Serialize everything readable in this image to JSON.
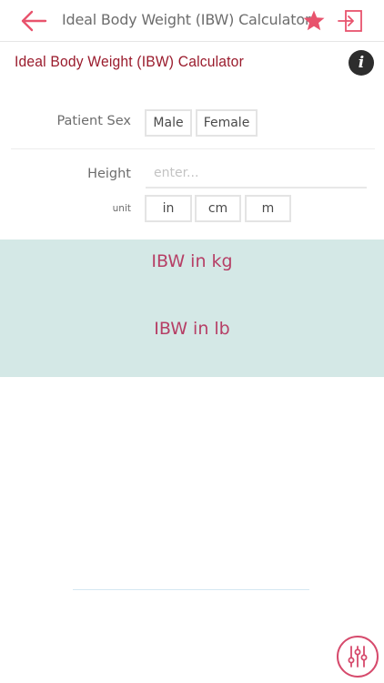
{
  "navbar": {
    "title": "Ideal Body Weight (IBW) Calculator",
    "back_icon": "arrow-left-icon",
    "favorite_icon": "star-icon",
    "exit_icon": "exit-icon"
  },
  "header": {
    "title": "Ideal Body Weight (IBW) Calculator",
    "info_glyph": "i"
  },
  "form": {
    "sex": {
      "label": "Patient Sex",
      "options": [
        "Male",
        "Female"
      ]
    },
    "height": {
      "label": "Height",
      "value": "",
      "placeholder": "enter...",
      "unit_label": "unit",
      "units": [
        "in",
        "cm",
        "m"
      ]
    }
  },
  "results": {
    "kg_label": "IBW in kg",
    "lb_label": "IBW in lb"
  },
  "fab": {
    "icon": "sliders-icon"
  },
  "colors": {
    "accent": "#e8536d",
    "title": "#9a1b2c",
    "result_text": "#b63f66",
    "result_bg": "#d4e8e6"
  }
}
